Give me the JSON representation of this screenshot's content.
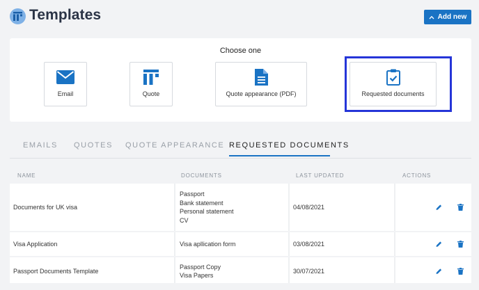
{
  "header": {
    "title": "Templates",
    "add_button": "Add new"
  },
  "chooser": {
    "label": "Choose one",
    "options": [
      {
        "label": "Email",
        "icon": "envelope-icon"
      },
      {
        "label": "Quote",
        "icon": "quote-icon"
      },
      {
        "label": "Quote appearance (PDF)",
        "icon": "document-icon"
      },
      {
        "label": "Requested documents",
        "icon": "clipboard-check-icon",
        "highlighted": true
      }
    ]
  },
  "tabs": [
    {
      "label": "EMAILS",
      "active": false
    },
    {
      "label": "QUOTES",
      "active": false
    },
    {
      "label": "QUOTE APPEARANCE",
      "active": false
    },
    {
      "label": "REQUESTED DOCUMENTS",
      "active": true
    }
  ],
  "table": {
    "columns": [
      "NAME",
      "DOCUMENTS",
      "LAST UPDATED",
      "ACTIONS"
    ],
    "rows": [
      {
        "name": "Documents for UK visa",
        "documents": [
          "Passport",
          "Bank statement",
          "Personal statement",
          "CV"
        ],
        "last_updated": "04/08/2021"
      },
      {
        "name": "Visa Application",
        "documents": [
          "Visa apllication form"
        ],
        "last_updated": "03/08/2021"
      },
      {
        "name": "Passport Documents Template",
        "documents": [
          "Passport Copy",
          "Visa Papers"
        ],
        "last_updated": "30/07/2021"
      }
    ]
  },
  "colors": {
    "accent": "#1a73c4",
    "highlight_border": "#2535d8",
    "background": "#f2f3f5"
  }
}
